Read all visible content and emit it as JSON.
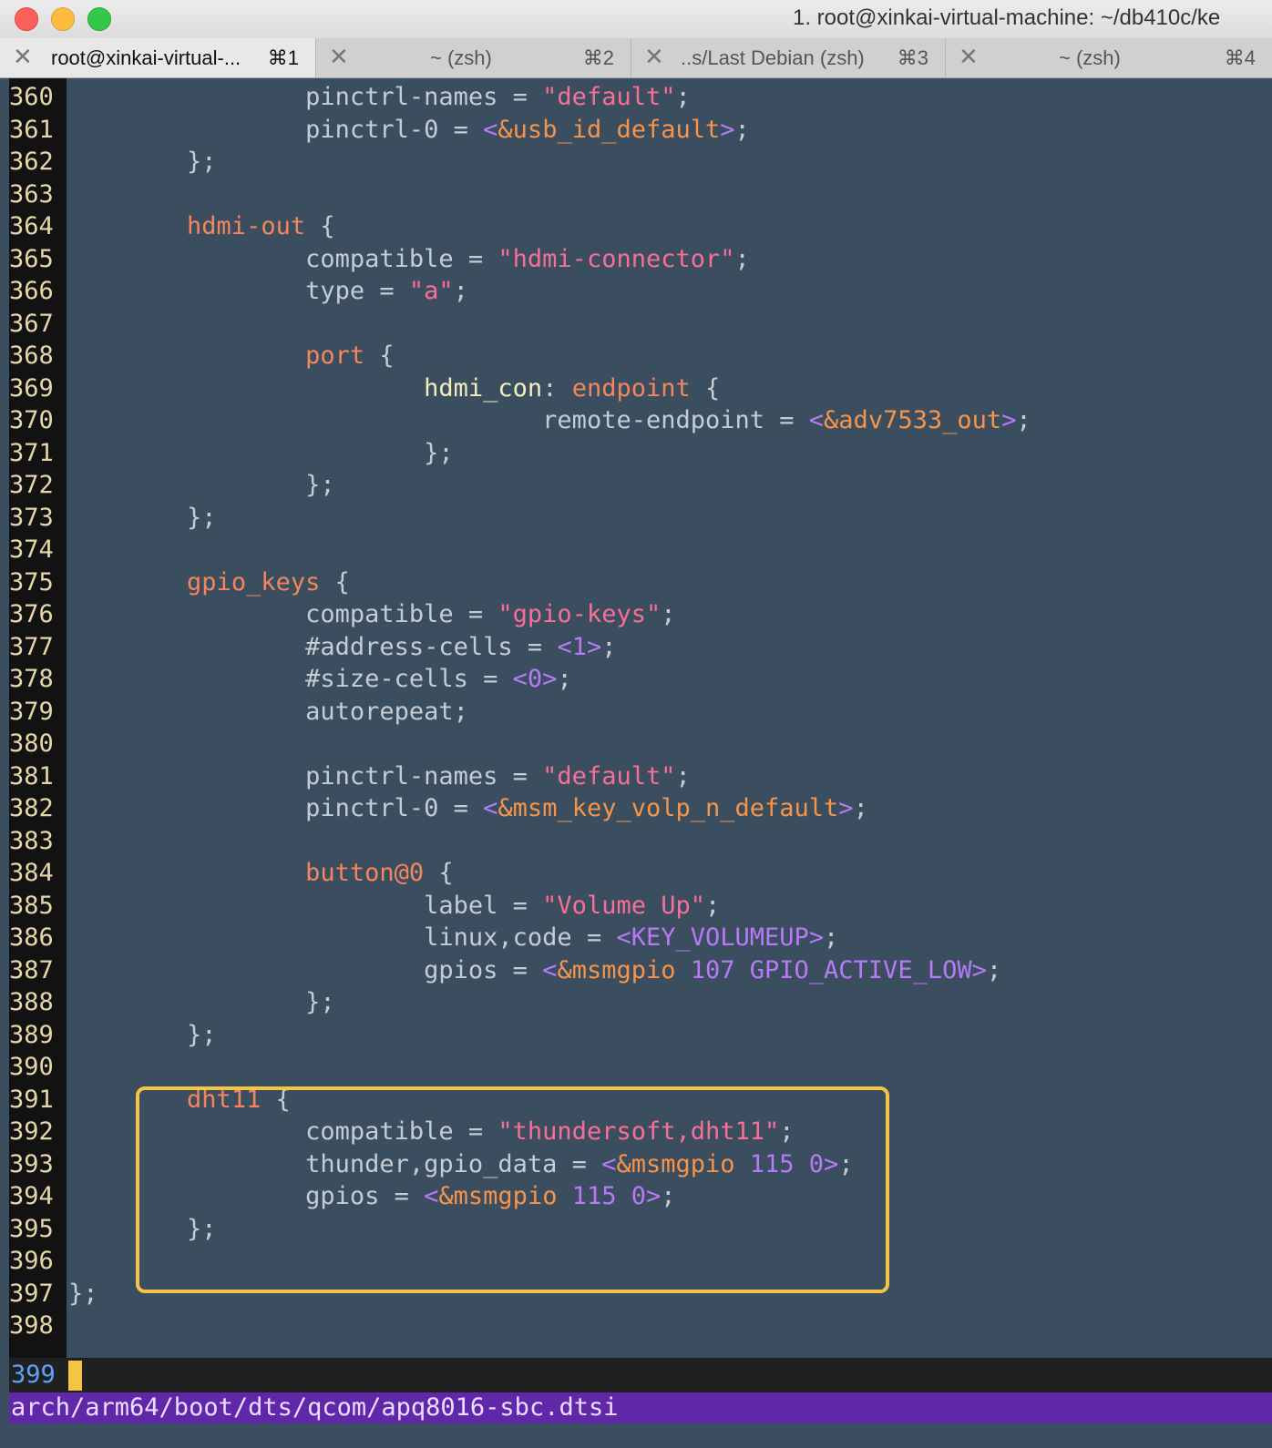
{
  "window": {
    "title": "1. root@xinkai-virtual-machine: ~/db410c/ke"
  },
  "tabs": [
    {
      "label": "root@xinkai-virtual-...",
      "shortcut": "⌘1",
      "active": true
    },
    {
      "label": "~ (zsh)",
      "shortcut": "⌘2",
      "active": false
    },
    {
      "label": "..s/Last Debian (zsh)",
      "shortcut": "⌘3",
      "active": false
    },
    {
      "label": "~ (zsh)",
      "shortcut": "⌘4",
      "active": false
    }
  ],
  "editor": {
    "lines": [
      {
        "n": "360",
        "tokens": [
          [
            "t",
            "                pinctrl-names = "
          ],
          [
            "s",
            "\"default\""
          ],
          [
            "t",
            ";"
          ]
        ]
      },
      {
        "n": "361",
        "tokens": [
          [
            "t",
            "                pinctrl-0 = "
          ],
          [
            "p",
            "<"
          ],
          [
            "r",
            "&usb_id_default"
          ],
          [
            "p",
            ">"
          ],
          [
            "t",
            ";"
          ]
        ]
      },
      {
        "n": "362",
        "tokens": [
          [
            "t",
            "        };"
          ]
        ]
      },
      {
        "n": "363",
        "tokens": []
      },
      {
        "n": "364",
        "tokens": [
          [
            "t",
            "        "
          ],
          [
            "k",
            "hdmi-out"
          ],
          [
            "t",
            " {"
          ]
        ]
      },
      {
        "n": "365",
        "tokens": [
          [
            "t",
            "                compatible = "
          ],
          [
            "s",
            "\"hdmi-connector\""
          ],
          [
            "t",
            ";"
          ]
        ]
      },
      {
        "n": "366",
        "tokens": [
          [
            "t",
            "                type = "
          ],
          [
            "s",
            "\"a\""
          ],
          [
            "t",
            ";"
          ]
        ]
      },
      {
        "n": "367",
        "tokens": []
      },
      {
        "n": "368",
        "tokens": [
          [
            "t",
            "                "
          ],
          [
            "k",
            "port"
          ],
          [
            "t",
            " {"
          ]
        ]
      },
      {
        "n": "369",
        "tokens": [
          [
            "t",
            "                        "
          ],
          [
            "lb",
            "hdmi_con"
          ],
          [
            "t",
            ": "
          ],
          [
            "k",
            "endpoint"
          ],
          [
            "t",
            " {"
          ]
        ]
      },
      {
        "n": "370",
        "tokens": [
          [
            "t",
            "                                remote-endpoint = "
          ],
          [
            "p",
            "<"
          ],
          [
            "r",
            "&adv7533_out"
          ],
          [
            "p",
            ">"
          ],
          [
            "t",
            ";"
          ]
        ]
      },
      {
        "n": "371",
        "tokens": [
          [
            "t",
            "                        };"
          ]
        ]
      },
      {
        "n": "372",
        "tokens": [
          [
            "t",
            "                };"
          ]
        ]
      },
      {
        "n": "373",
        "tokens": [
          [
            "t",
            "        };"
          ]
        ]
      },
      {
        "n": "374",
        "tokens": []
      },
      {
        "n": "375",
        "tokens": [
          [
            "t",
            "        "
          ],
          [
            "k",
            "gpio_keys"
          ],
          [
            "t",
            " {"
          ]
        ]
      },
      {
        "n": "376",
        "tokens": [
          [
            "t",
            "                compatible = "
          ],
          [
            "s",
            "\"gpio-keys\""
          ],
          [
            "t",
            ";"
          ]
        ]
      },
      {
        "n": "377",
        "tokens": [
          [
            "t",
            "                #address-cells = "
          ],
          [
            "p",
            "<1>"
          ],
          [
            "t",
            ";"
          ]
        ]
      },
      {
        "n": "378",
        "tokens": [
          [
            "t",
            "                #size-cells = "
          ],
          [
            "p",
            "<0>"
          ],
          [
            "t",
            ";"
          ]
        ]
      },
      {
        "n": "379",
        "tokens": [
          [
            "t",
            "                autorepeat;"
          ]
        ]
      },
      {
        "n": "380",
        "tokens": []
      },
      {
        "n": "381",
        "tokens": [
          [
            "t",
            "                pinctrl-names = "
          ],
          [
            "s",
            "\"default\""
          ],
          [
            "t",
            ";"
          ]
        ]
      },
      {
        "n": "382",
        "tokens": [
          [
            "t",
            "                pinctrl-0 = "
          ],
          [
            "p",
            "<"
          ],
          [
            "r",
            "&msm_key_volp_n_default"
          ],
          [
            "p",
            ">"
          ],
          [
            "t",
            ";"
          ]
        ]
      },
      {
        "n": "383",
        "tokens": []
      },
      {
        "n": "384",
        "tokens": [
          [
            "t",
            "                "
          ],
          [
            "k",
            "button@0"
          ],
          [
            "t",
            " {"
          ]
        ]
      },
      {
        "n": "385",
        "tokens": [
          [
            "t",
            "                        label = "
          ],
          [
            "s",
            "\"Volume Up\""
          ],
          [
            "t",
            ";"
          ]
        ]
      },
      {
        "n": "386",
        "tokens": [
          [
            "t",
            "                        linux,code = "
          ],
          [
            "p",
            "<KEY_VOLUMEUP>"
          ],
          [
            "t",
            ";"
          ]
        ]
      },
      {
        "n": "387",
        "tokens": [
          [
            "t",
            "                        gpios = "
          ],
          [
            "p",
            "<"
          ],
          [
            "r",
            "&msmgpio"
          ],
          [
            "p",
            " 107 GPIO_ACTIVE_LOW>"
          ],
          [
            "t",
            ";"
          ]
        ]
      },
      {
        "n": "388",
        "tokens": [
          [
            "t",
            "                };"
          ]
        ]
      },
      {
        "n": "389",
        "tokens": [
          [
            "t",
            "        };"
          ]
        ]
      },
      {
        "n": "390",
        "tokens": []
      },
      {
        "n": "391",
        "tokens": [
          [
            "t",
            "        "
          ],
          [
            "k",
            "dht11"
          ],
          [
            "t",
            " {"
          ]
        ]
      },
      {
        "n": "392",
        "tokens": [
          [
            "t",
            "                compatible = "
          ],
          [
            "s",
            "\"thundersoft,dht11\""
          ],
          [
            "t",
            ";"
          ]
        ]
      },
      {
        "n": "393",
        "tokens": [
          [
            "t",
            "                thunder,gpio_data = "
          ],
          [
            "p",
            "<"
          ],
          [
            "r",
            "&msmgpio"
          ],
          [
            "p",
            " 115 0>"
          ],
          [
            "t",
            ";"
          ]
        ]
      },
      {
        "n": "394",
        "tokens": [
          [
            "t",
            "                gpios = "
          ],
          [
            "p",
            "<"
          ],
          [
            "r",
            "&msmgpio"
          ],
          [
            "p",
            " 115 0>"
          ],
          [
            "t",
            ";"
          ]
        ]
      },
      {
        "n": "395",
        "tokens": [
          [
            "t",
            "        };"
          ]
        ]
      },
      {
        "n": "396",
        "tokens": []
      },
      {
        "n": "397",
        "tokens": [
          [
            "t",
            "};"
          ]
        ]
      },
      {
        "n": "398",
        "tokens": []
      }
    ],
    "cursor_line_number": "399",
    "status_file": "arch/arm64/boot/dts/qcom/apq8016-sbc.dtsi"
  }
}
